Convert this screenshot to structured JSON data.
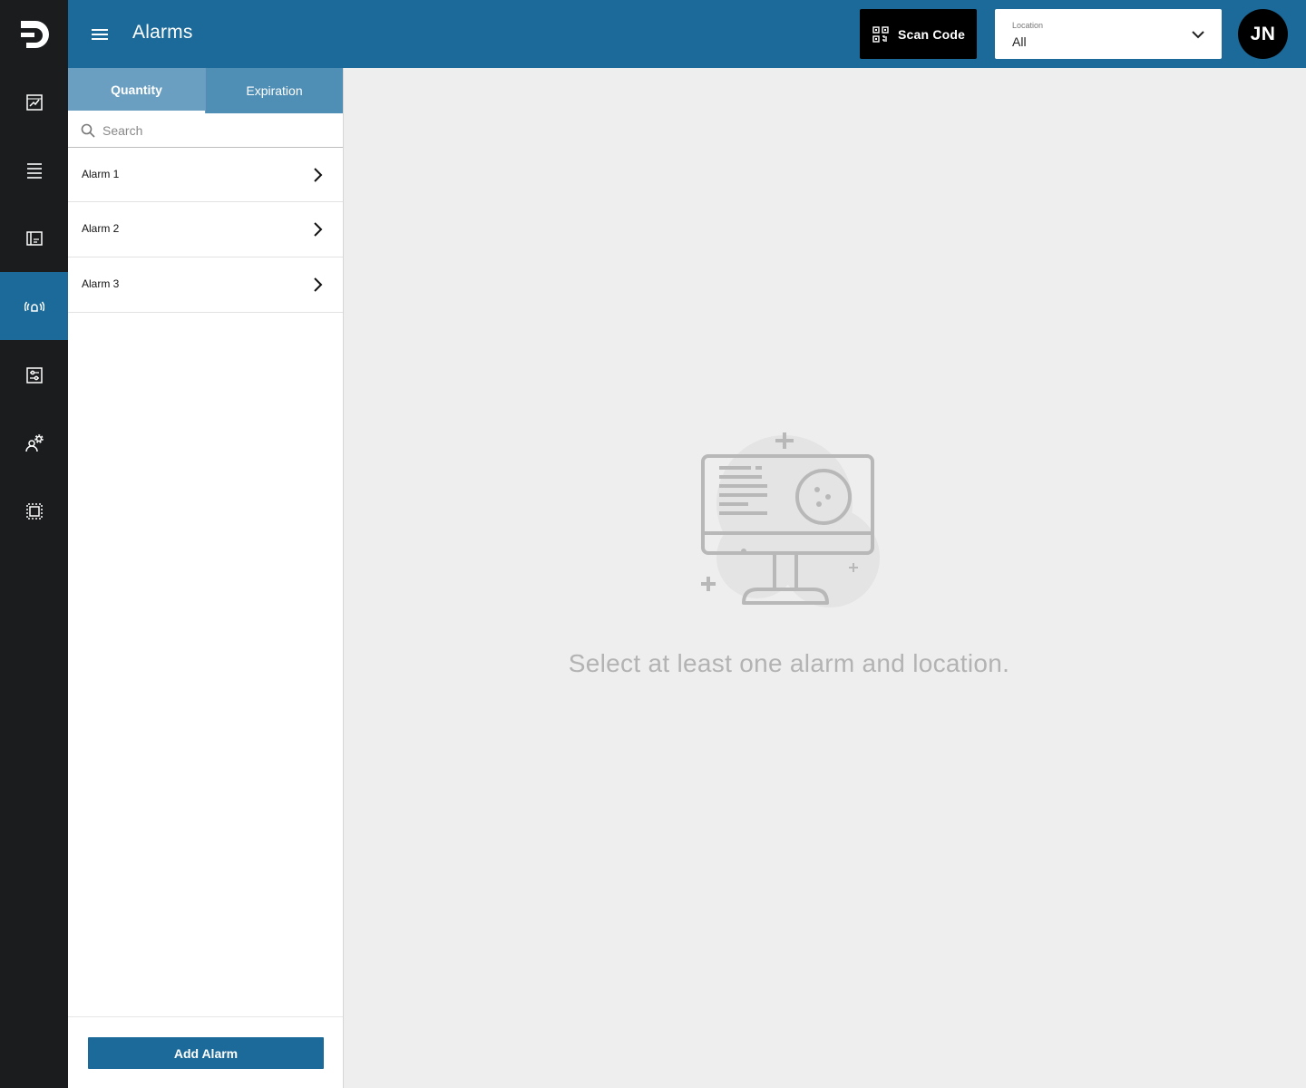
{
  "header": {
    "title": "Alarms",
    "scan_label": "Scan Code",
    "location": {
      "label": "Location",
      "value": "All"
    },
    "avatar_initials": "JN"
  },
  "rail": {
    "items": [
      {
        "icon": "dashboard-chart-icon",
        "active": false
      },
      {
        "icon": "list-icon",
        "active": false
      },
      {
        "icon": "card-icon",
        "active": false
      },
      {
        "icon": "alarm-broadcast-icon",
        "active": true
      },
      {
        "icon": "settings-list-icon",
        "active": false
      },
      {
        "icon": "user-settings-icon",
        "active": false
      },
      {
        "icon": "chip-icon",
        "active": false
      }
    ]
  },
  "panel": {
    "tabs": [
      {
        "label": "Quantity",
        "active": true
      },
      {
        "label": "Expiration",
        "active": false
      }
    ],
    "search_placeholder": "Search",
    "alarms": [
      {
        "label": "Alarm 1"
      },
      {
        "label": "Alarm 2"
      },
      {
        "label": "Alarm 3"
      }
    ],
    "add_label": "Add Alarm"
  },
  "empty_state": {
    "message": "Select at least one alarm and location."
  },
  "colors": {
    "brand": "#1b6a99",
    "rail": "#1b1c1e",
    "background": "#eeeeee"
  }
}
